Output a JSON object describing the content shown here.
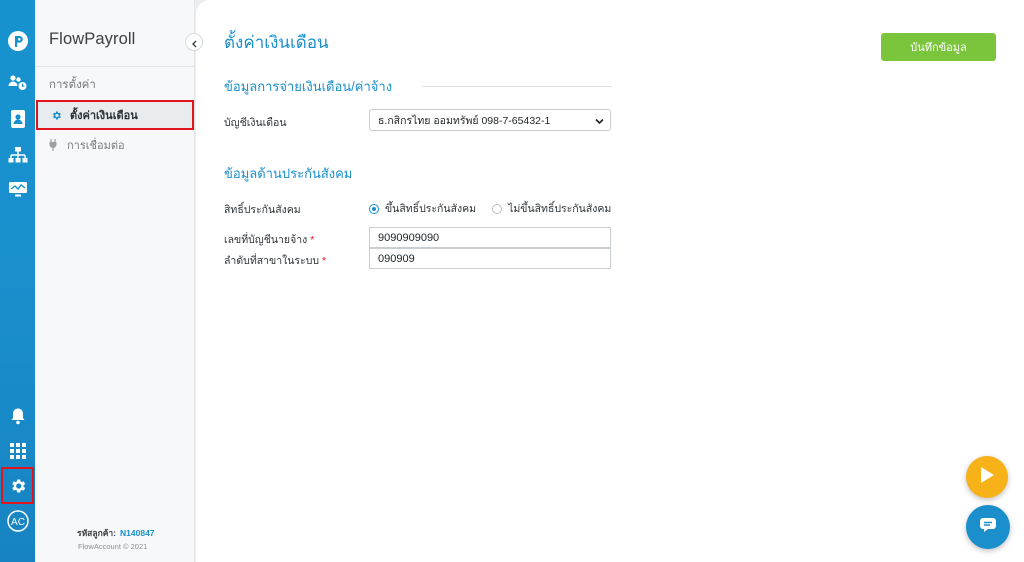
{
  "rail": {
    "items": [
      "logo-icon",
      "people-clock-icon",
      "id-card-icon",
      "org-chart-icon",
      "monitor-chart-icon",
      "bell-icon",
      "grid-icon",
      "gear-icon"
    ],
    "avatar_initials": "AC"
  },
  "sidebar": {
    "brand": "FlowPayroll",
    "section_label": "การตั้งค่า",
    "items": [
      {
        "label": "ตั้งค่าเงินเดือน",
        "icon": "gear-icon",
        "active": true
      },
      {
        "label": "การเชื่อมต่อ",
        "icon": "plug-icon",
        "active": false
      }
    ],
    "footer": {
      "customer_code_label": "รหัสลูกค้า:",
      "customer_code": "N140847",
      "copyright": "FlowAccount © 2021"
    }
  },
  "main": {
    "title": "ตั้งค่าเงินเดือน",
    "save_label": "บันทึกข้อมูล",
    "payment_section": {
      "heading": "ข้อมูลการจ่ายเงินเดือน/ค่าจ้าง",
      "account_label": "บัญชีเงินเดือน",
      "account_value": "ธ.กสิกรไทย ออมทรัพย์ 098-7-65432-1"
    },
    "social_section": {
      "heading": "ข้อมูลด้านประกันสังคม",
      "rights_label": "สิทธิ์ประกันสังคม",
      "option_yes": "ขึ้นสิทธิ์ประกันสังคม",
      "option_no": "ไม่ขึ้นสิทธิ์ประกันสังคม",
      "selected": "option_yes",
      "employer_account_label": "เลขที่บัญชีนายจ้าง",
      "employer_account_value": "9090909090",
      "branch_label": "ลำดับที่สาขาในระบบ",
      "branch_value": "090909",
      "required_mark": "*"
    }
  },
  "colors": {
    "accent": "#1a8fcc",
    "save": "#7ac53c",
    "highlight": "#e0151b",
    "fab_play": "#f7b21a"
  }
}
